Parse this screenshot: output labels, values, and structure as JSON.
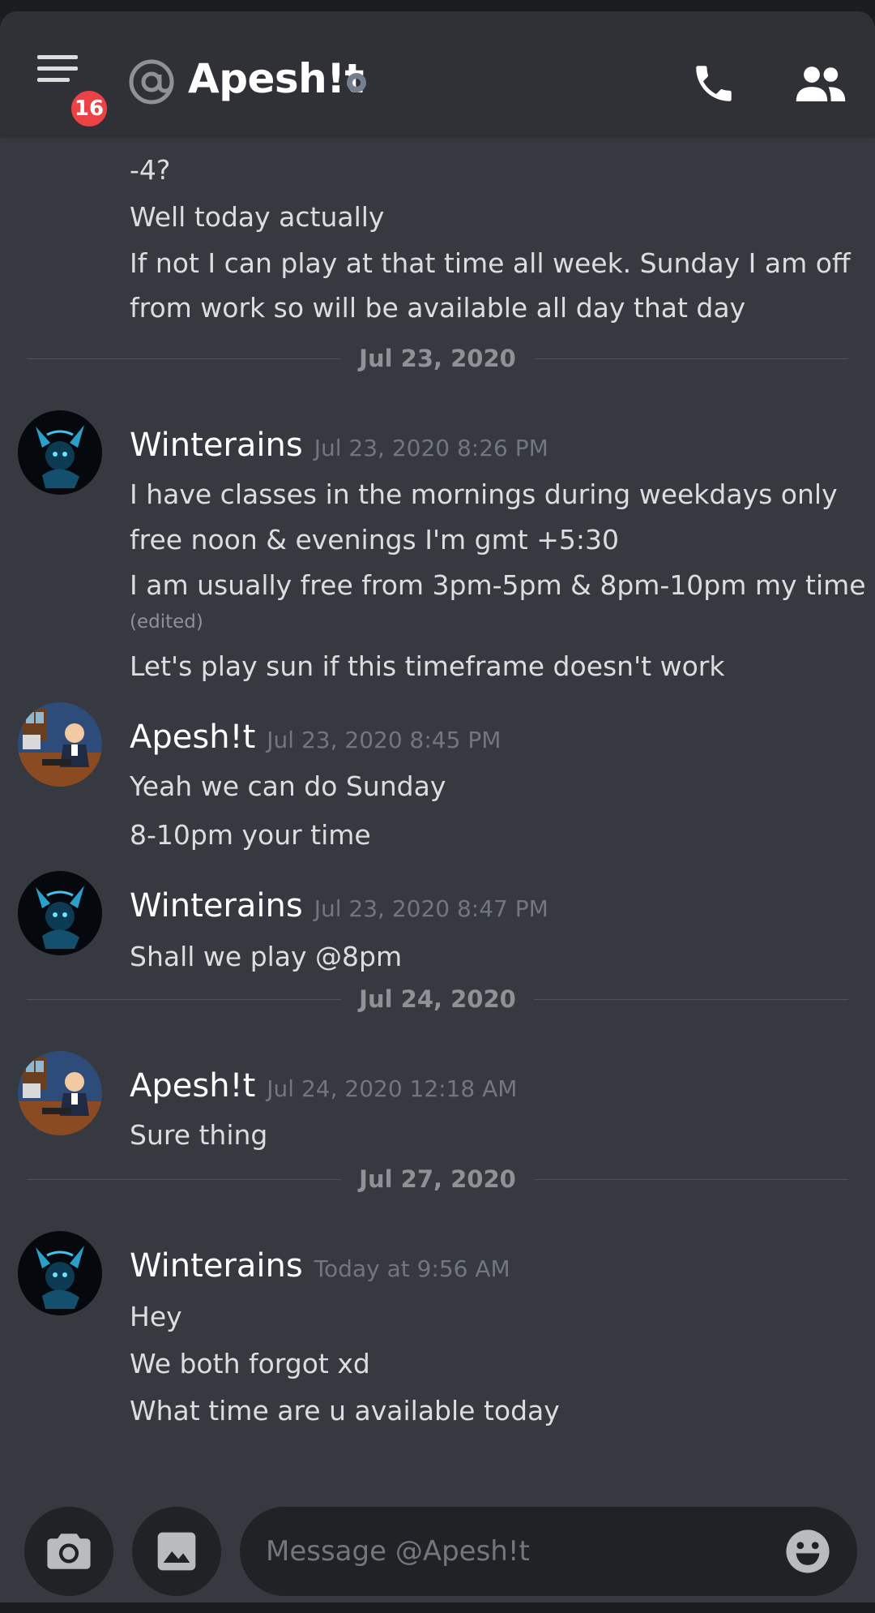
{
  "header": {
    "badge_count": "16",
    "title": "Apesh!t"
  },
  "partial_messages": [
    {
      "text": "-4?"
    },
    {
      "text": "Well today actually"
    },
    {
      "text": "If not I can play at that time all week. Sunday I am off"
    },
    {
      "text": "from work so will be available all day that day"
    }
  ],
  "dividers": [
    "Jul 23, 2020",
    "Jul 24, 2020",
    "Jul 27, 2020"
  ],
  "groups": [
    {
      "author": "Winterains",
      "timestamp": "Jul 23, 2020 8:26 PM",
      "lines": [
        "I have classes in the mornings during weekdays only",
        "free noon & evenings I'm gmt +5:30",
        "I am usually free from 3pm-5pm & 8pm-10pm  my time",
        "Let's play sun if this timeframe doesn't work"
      ],
      "edited_label": "(edited)"
    },
    {
      "author": "Apesh!t",
      "timestamp": "Jul 23, 2020 8:45 PM",
      "lines": [
        "Yeah we can do Sunday",
        "8-10pm your time"
      ]
    },
    {
      "author": "Winterains",
      "timestamp": "Jul 23, 2020 8:47 PM",
      "lines": [
        "Shall we play @8pm"
      ]
    },
    {
      "author": "Apesh!t",
      "timestamp": "Jul 24, 2020 12:18 AM",
      "lines": [
        "Sure thing"
      ]
    },
    {
      "author": "Winterains",
      "timestamp": "Today at 9:56 AM",
      "lines": [
        "Hey",
        "We both forgot xd",
        "What time are u available today"
      ]
    }
  ],
  "composer": {
    "placeholder": "Message @Apesh!t"
  },
  "icons": {
    "menu": "hamburger-menu-icon",
    "at": "at-sign-icon",
    "call": "phone-icon",
    "members": "people-icon",
    "camera": "camera-icon",
    "gallery": "image-icon",
    "emoji": "emoji-icon"
  },
  "colors": {
    "background": "#36393f",
    "header": "#2f3136",
    "badge": "#ed4245",
    "input": "#202225"
  }
}
